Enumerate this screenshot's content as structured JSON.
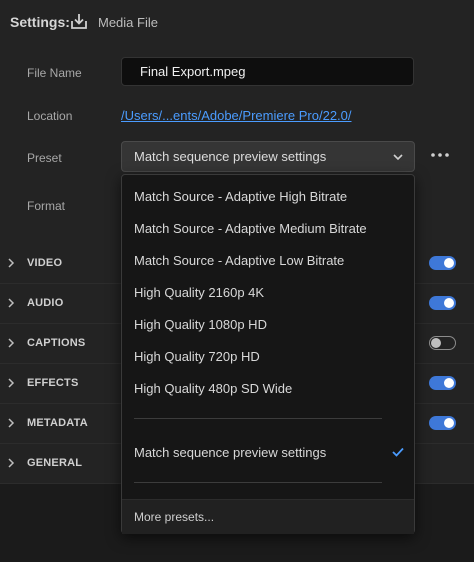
{
  "header": {
    "settings_label": "Settings:",
    "media_label": "Media File",
    "media_icon": "download-tray-icon"
  },
  "form": {
    "file_name_label": "File Name",
    "file_name_value": "Final Export.mpeg",
    "location_label": "Location",
    "location_value": "/Users/...ents/Adobe/Premiere Pro/22.0/",
    "preset_label": "Preset",
    "preset_value": "Match sequence preview settings",
    "format_label": "Format"
  },
  "sections": [
    {
      "label": "VIDEO",
      "toggle": true
    },
    {
      "label": "AUDIO",
      "toggle": true
    },
    {
      "label": "CAPTIONS",
      "toggle": false
    },
    {
      "label": "EFFECTS",
      "toggle": true
    },
    {
      "label": "METADATA",
      "toggle": true
    },
    {
      "label": "GENERAL",
      "toggle": null
    }
  ],
  "dropdown": {
    "items": [
      "Match Source - Adaptive High Bitrate",
      "Match Source - Adaptive Medium Bitrate",
      "Match Source - Adaptive Low Bitrate",
      "High Quality 2160p 4K",
      "High Quality 1080p HD",
      "High Quality 720p HD",
      "High Quality 480p SD Wide"
    ],
    "selected": "Match sequence preview settings",
    "footer": "More presets..."
  },
  "colors": {
    "accent": "#3e78d8",
    "link": "#4b9cff",
    "background": "#232323"
  }
}
